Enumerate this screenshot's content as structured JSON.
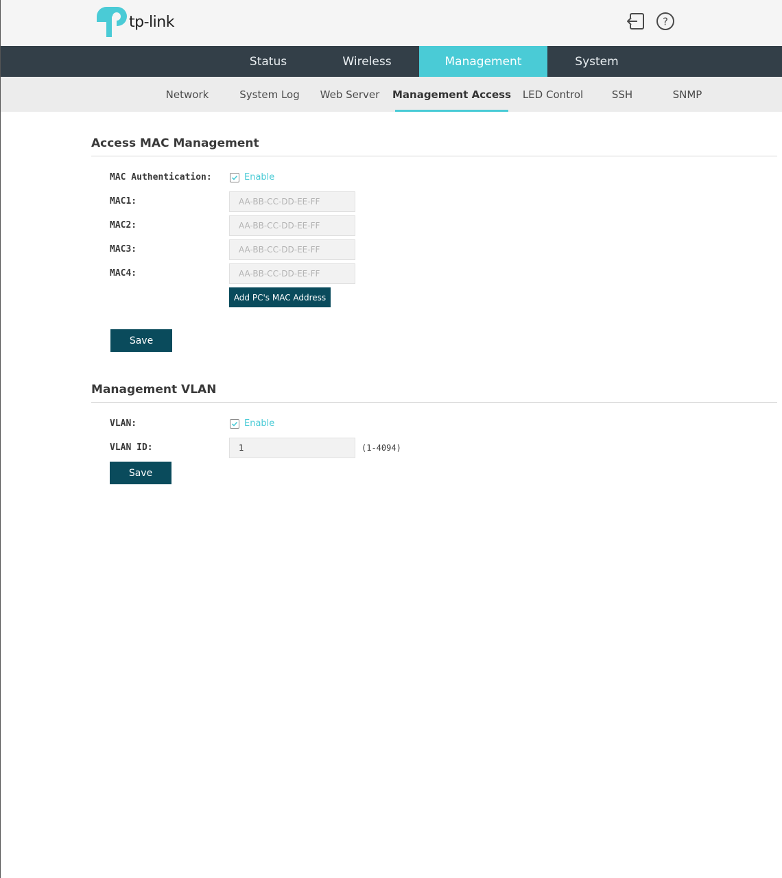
{
  "header": {
    "logo_text": "tp-link",
    "brand_color": "#4acbd6",
    "icons": {
      "logout": "logout-icon",
      "help": "help-icon"
    }
  },
  "main_nav": {
    "tabs": [
      {
        "label": "Status",
        "active": false
      },
      {
        "label": "Wireless",
        "active": false
      },
      {
        "label": "Management",
        "active": true
      },
      {
        "label": "System",
        "active": false
      }
    ]
  },
  "sub_nav": {
    "items": [
      {
        "label": "Network",
        "active": false
      },
      {
        "label": "System Log",
        "active": false
      },
      {
        "label": "Web Server",
        "active": false
      },
      {
        "label": "Management Access",
        "active": true
      },
      {
        "label": "LED Control",
        "active": false
      },
      {
        "label": "SSH",
        "active": false
      },
      {
        "label": "SNMP",
        "active": false
      }
    ]
  },
  "access_mac": {
    "title": "Access MAC Management",
    "auth_label": "MAC Authentication:",
    "auth_enable_label": "Enable",
    "auth_checked": true,
    "mac_fields": [
      {
        "label": "MAC1:",
        "value": "",
        "placeholder": "AA-BB-CC-DD-EE-FF"
      },
      {
        "label": "MAC2:",
        "value": "",
        "placeholder": "AA-BB-CC-DD-EE-FF"
      },
      {
        "label": "MAC3:",
        "value": "",
        "placeholder": "AA-BB-CC-DD-EE-FF"
      },
      {
        "label": "MAC4:",
        "value": "",
        "placeholder": "AA-BB-CC-DD-EE-FF"
      }
    ],
    "add_pc_mac_label": "Add PC's MAC Address",
    "save_label": "Save"
  },
  "mgmt_vlan": {
    "title": "Management VLAN",
    "vlan_label": "VLAN:",
    "vlan_enable_label": "Enable",
    "vlan_checked": true,
    "vlan_id_label": "VLAN ID:",
    "vlan_id_value": "1",
    "vlan_id_range": "(1-4094)",
    "save_label": "Save"
  },
  "colors": {
    "nav_bg": "#333f48",
    "subnav_bg": "#ececec",
    "accent": "#4acbd6",
    "button": "#0a4b5c"
  }
}
